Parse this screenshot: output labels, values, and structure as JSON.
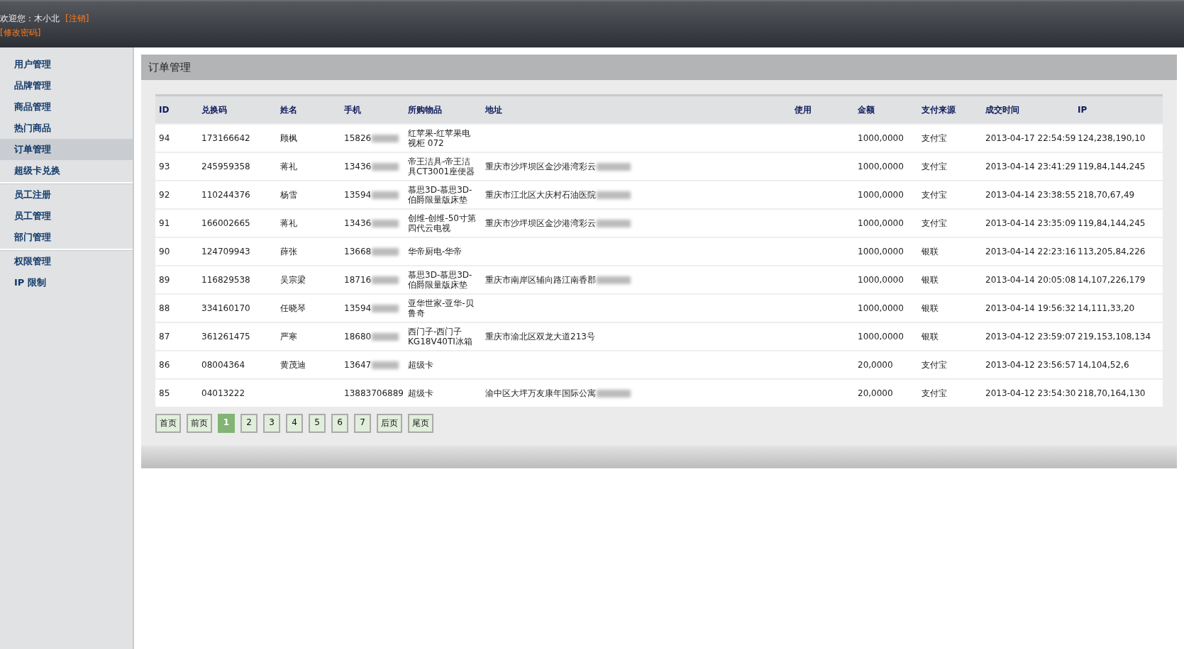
{
  "header": {
    "welcome": "欢迎您：木小北",
    "logout": "[注销]",
    "change_password": "[修改密码]"
  },
  "sidebar": {
    "groups": [
      {
        "items": [
          {
            "label": "用户管理",
            "selected": false
          },
          {
            "label": "品牌管理",
            "selected": false
          },
          {
            "label": "商品管理",
            "selected": false
          },
          {
            "label": "热门商品",
            "selected": false
          },
          {
            "label": "订单管理",
            "selected": true
          },
          {
            "label": "超级卡兑换",
            "selected": false
          }
        ]
      },
      {
        "items": [
          {
            "label": "员工注册",
            "selected": false
          },
          {
            "label": "员工管理",
            "selected": false
          },
          {
            "label": "部门管理",
            "selected": false
          }
        ]
      },
      {
        "items": [
          {
            "label": "权限管理",
            "selected": false
          },
          {
            "label": "IP 限制",
            "selected": false
          }
        ]
      }
    ]
  },
  "panel": {
    "title": "订单管理"
  },
  "table": {
    "columns": [
      "ID",
      "兑换码",
      "姓名",
      "手机",
      "所购物品",
      "地址",
      "使用",
      "金额",
      "支付来源",
      "成交时间",
      "IP"
    ],
    "rows": [
      {
        "id": "94",
        "code": "173166642",
        "name": "顾枫",
        "phone": "15826",
        "phone_redacted": true,
        "item": "红苹果-红苹果电视柜 072",
        "address": "",
        "address_redacted": false,
        "amount": "1000,0000",
        "source": "支付宝",
        "time": "2013-04-17 22:54:59",
        "ip": "124,238,190,10"
      },
      {
        "id": "93",
        "code": "245959358",
        "name": "蒋礼",
        "phone": "13436",
        "phone_redacted": true,
        "item": "帝王洁具-帝王洁具CT3001座便器",
        "address": "重庆市沙坪坝区金沙港湾彩云",
        "address_redacted": true,
        "amount": "1000,0000",
        "source": "支付宝",
        "time": "2013-04-14 23:41:29",
        "ip": "119,84,144,245"
      },
      {
        "id": "92",
        "code": "110244376",
        "name": "杨雪",
        "phone": "13594",
        "phone_redacted": true,
        "item": "慕思3D-慕思3D-伯爵限量版床垫",
        "address": "重庆市江北区大庆村石油医院",
        "address_redacted": true,
        "amount": "1000,0000",
        "source": "支付宝",
        "time": "2013-04-14 23:38:55",
        "ip": "218,70,67,49"
      },
      {
        "id": "91",
        "code": "166002665",
        "name": "蒋礼",
        "phone": "13436",
        "phone_redacted": true,
        "item": "创维-创维-50寸第四代云电视",
        "address": "重庆市沙坪坝区金沙港湾彩云",
        "address_redacted": true,
        "amount": "1000,0000",
        "source": "支付宝",
        "time": "2013-04-14 23:35:09",
        "ip": "119,84,144,245"
      },
      {
        "id": "90",
        "code": "124709943",
        "name": "薛张",
        "phone": "13668",
        "phone_redacted": true,
        "item": "华帝厨电-华帝",
        "address": "",
        "address_redacted": false,
        "amount": "1000,0000",
        "source": "银联",
        "time": "2013-04-14 22:23:16",
        "ip": "113,205,84,226"
      },
      {
        "id": "89",
        "code": "116829538",
        "name": "吴宗梁",
        "phone": "18716",
        "phone_redacted": true,
        "item": "慕思3D-慕思3D-伯爵限量版床垫",
        "address": "重庆市南岸区辅向路江南香郡",
        "address_redacted": true,
        "amount": "1000,0000",
        "source": "银联",
        "time": "2013-04-14 20:05:08",
        "ip": "14,107,226,179"
      },
      {
        "id": "88",
        "code": "334160170",
        "name": "任晓琴",
        "phone": "13594",
        "phone_redacted": true,
        "item": "亚华世家-亚华-贝鲁奇",
        "address": "",
        "address_redacted": false,
        "amount": "1000,0000",
        "source": "银联",
        "time": "2013-04-14 19:56:32",
        "ip": "14,111,33,20"
      },
      {
        "id": "87",
        "code": "361261475",
        "name": "严寒",
        "phone": "18680",
        "phone_redacted": true,
        "item": "西门子-西门子KG18V40TI冰箱",
        "address": "重庆市渝北区双龙大道213号",
        "address_redacted": false,
        "amount": "1000,0000",
        "source": "银联",
        "time": "2013-04-12 23:59:07",
        "ip": "219,153,108,134"
      },
      {
        "id": "86",
        "code": "08004364",
        "name": "黄茂迪",
        "phone": "13647",
        "phone_redacted": true,
        "item": "超级卡",
        "address": "",
        "address_redacted": false,
        "amount": "20,0000",
        "source": "支付宝",
        "time": "2013-04-12 23:56:57",
        "ip": "14,104,52,6"
      },
      {
        "id": "85",
        "code": "04013222",
        "name": "",
        "phone": "13883706889",
        "phone_redacted": false,
        "item": "超级卡",
        "address": "渝中区大坪万友康年国际公寓",
        "address_redacted": true,
        "amount": "20,0000",
        "source": "支付宝",
        "time": "2013-04-12 23:54:30",
        "ip": "218,70,164,130"
      }
    ]
  },
  "pagination": [
    {
      "label": "首页",
      "selected": false
    },
    {
      "label": "前页",
      "selected": false
    },
    {
      "label": "1",
      "selected": true
    },
    {
      "label": "2",
      "selected": false
    },
    {
      "label": "3",
      "selected": false
    },
    {
      "label": "4",
      "selected": false
    },
    {
      "label": "5",
      "selected": false
    },
    {
      "label": "6",
      "selected": false
    },
    {
      "label": "7",
      "selected": false
    },
    {
      "label": "后页",
      "selected": false
    },
    {
      "label": "尾页",
      "selected": false
    }
  ]
}
